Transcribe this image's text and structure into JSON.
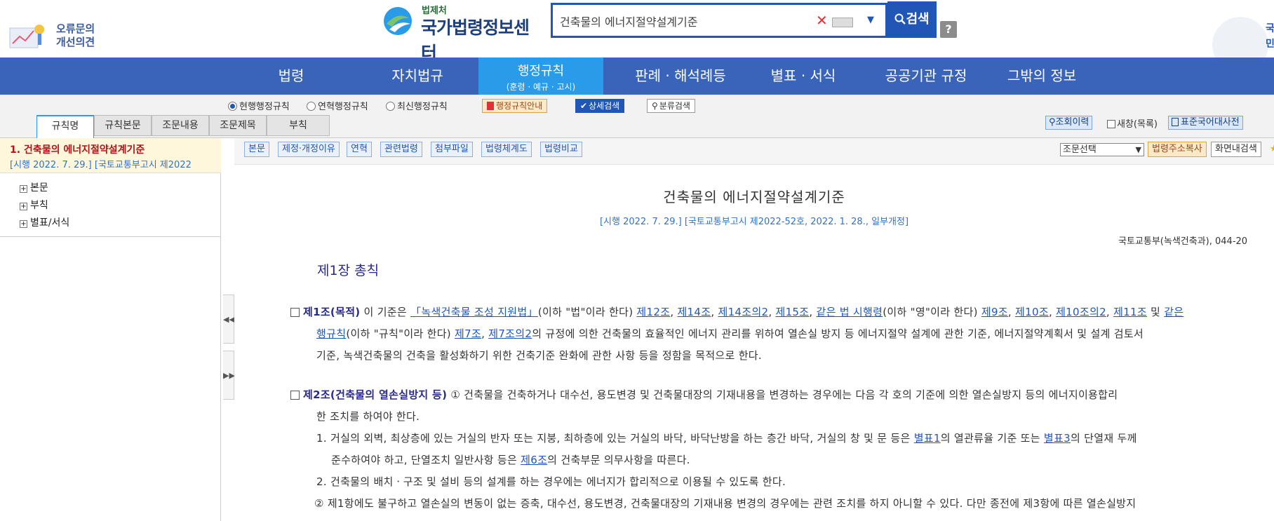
{
  "header": {
    "error_report": {
      "line1": "오류문의",
      "line2": "개선의견"
    },
    "brand": {
      "sub": "법제처",
      "main": "국가법령정보센터"
    },
    "search": {
      "value": "건축물의 에너지절약설계기준",
      "clear": "✕",
      "dropdown": "▼",
      "button": "검색"
    },
    "help": "?",
    "right_logo": {
      "line1": "국",
      "line2": "민"
    }
  },
  "nav": {
    "items": [
      "법령",
      "자치법규",
      "행정규칙",
      "판례 · 해석례등",
      "별표 · 서식",
      "공공기관 규정",
      "그밖의 정보"
    ],
    "active_sub": "(훈령 · 예규 · 고시)"
  },
  "subbar": {
    "radios": [
      "현행행정규칙",
      "연혁행정규칙",
      "최신행정규칙"
    ],
    "guide": "행정규칙안내",
    "detail_search": "상세검색",
    "category_search": "분류검색",
    "tabs": [
      "규칙명",
      "규칙본문",
      "조문내용",
      "조문제목",
      "부칙"
    ],
    "right": {
      "history": "조회이력",
      "new_window": "새창(목록)",
      "dictionary": "표준국어대사전"
    }
  },
  "left": {
    "title": "1.  건축물의 에너지절약설계기준",
    "sub": "[시행 2022. 7. 29.] [국토교통부고시 제2022",
    "tree": [
      "본문",
      "부칙",
      "별표/서식"
    ]
  },
  "toolbar": {
    "buttons": [
      "본문",
      "제정·개정이유",
      "연혁",
      "관련법령",
      "첨부파일",
      "법령체계도",
      "법령비교"
    ],
    "select": "조문선택",
    "copy_url": "법령주소복사",
    "find": "화면내검색"
  },
  "doc": {
    "title": "건축물의 에너지절약설계기준",
    "sub": "[시행 2022. 7. 29.] [국토교통부고시 제2022-52호, 2022. 1. 28., 일부개정]",
    "ministry": "국토교통부(녹색건축과), 044-20",
    "chapter": "제1장 총칙",
    "a1": {
      "head": "제1조(목적)",
      "t1": " 이 기준은 ",
      "l1": "「녹색건축물 조성 지원법」",
      "t2": "(이하 \"법\"이라 한다) ",
      "l2": "제12조",
      "l3": "제14조",
      "l4": "제14조의2",
      "l5": "제15조",
      "l6": "같은 법 시행령",
      "t3": "(이하 \"영\"이라 한다) ",
      "l7": "제9조",
      "l8": "제10조",
      "l9": "제10조의2",
      "l10": "제11조",
      "t4": " 및 ",
      "l11": "같은",
      "line2_link": "행규칙",
      "line2_t1": "(이하 \"규칙\"이라 한다) ",
      "line2_l2": "제7조",
      "line2_l3": "제7조의2",
      "line2_t2": "의 규정에 의한 건축물의 효율적인 에너지 관리를 위하여 열손실 방지 등 에너지절약 설계에 관한 기준, 에너지절약계획서 및 설계 검토서",
      "line3": "기준, 녹색건축물의 건축을 활성화하기 위한 건축기준 완화에 관한 사항 등을 정함을 목적으로 한다."
    },
    "a2": {
      "head": "제2조(건축물의 열손실방지 등)",
      "t1": "  ① 건축물을 건축하거나 대수선, 용도변경 및 건축물대장의 기재내용을 변경하는 경우에는 다음 각 호의 기준에 의한 열손실방지 등의 에너지이용합리",
      "line2": "한 조치를 하여야 한다.",
      "i1_t1": "1. 거실의 외벽, 최상층에 있는 거실의 반자 또는 지붕, 최하층에 있는 거실의 바닥, 바닥난방을 하는 층간 바닥, 거실의 창 및 문 등은 ",
      "i1_l1": "별표1",
      "i1_t2": "의 열관류율 기준 또는 ",
      "i1_l2": "별표3",
      "i1_t3": "의 단열재 두께",
      "i1b_t1": "준수하여야 하고, 단열조치 일반사항 등은 ",
      "i1b_l1": "제6조",
      "i1b_t2": "의 건축부문 의무사항을 따른다.",
      "i2": "2. 건축물의 배치ㆍ구조 및 설비 등의 설계를 하는 경우에는 에너지가 합리적으로 이용될 수 있도록 한다.",
      "p2": "② 제1항에도 불구하고 열손실의 변동이 없는 증축, 대수선, 용도변경, 건축물대장의 기재내용 변경의 경우에는 관련 조치를 하지 아니할 수 있다. 다만 종전에 제3항에 따른 열손실방지"
    }
  },
  "colors": {
    "nav": "#3a64b9",
    "nav_active": "#2a9be8",
    "search": "#2156b7",
    "title_red": "#b3121a",
    "link": "#2156b7"
  }
}
